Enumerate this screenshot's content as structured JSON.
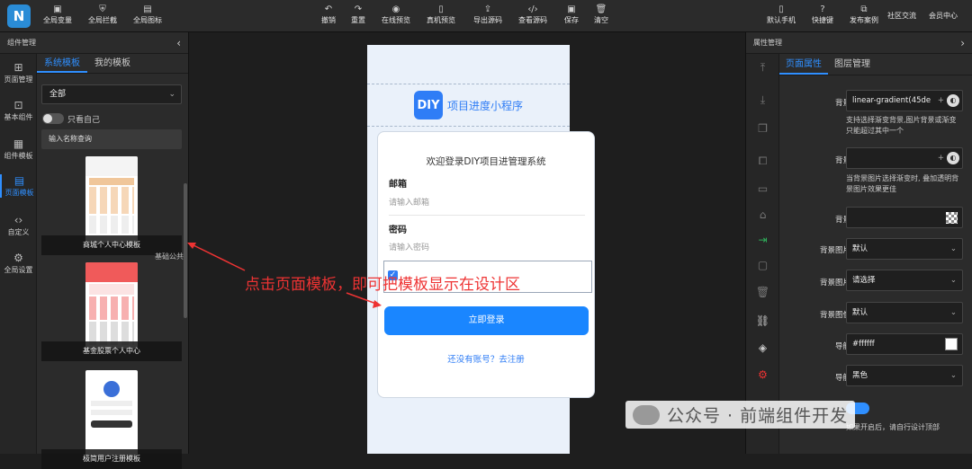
{
  "toolbar": {
    "left": [
      {
        "label": "全局变量",
        "icon": "code-icon"
      },
      {
        "label": "全局拦截",
        "icon": "shield-icon"
      },
      {
        "label": "全局图标",
        "icon": "image-icon"
      }
    ],
    "center": [
      {
        "label": "撤销",
        "icon": "undo-icon"
      },
      {
        "label": "重置",
        "icon": "redo-icon"
      },
      {
        "label": "在线预览",
        "icon": "eye-icon"
      },
      {
        "label": "真机预览",
        "icon": "phone-icon"
      },
      {
        "label": "导出源码",
        "icon": "export-icon"
      },
      {
        "label": "查看源码",
        "icon": "code-icon"
      },
      {
        "label": "保存",
        "icon": "save-icon"
      },
      {
        "label": "清空",
        "icon": "trash-icon"
      }
    ],
    "right": [
      {
        "label": "默认手机",
        "icon": "phone-icon"
      },
      {
        "label": "快捷键",
        "icon": "help-icon"
      },
      {
        "label": "发布案例",
        "icon": "publish-icon"
      },
      {
        "label": "社区交流",
        "icon": ""
      },
      {
        "label": "会员中心",
        "icon": ""
      }
    ]
  },
  "left_panel": {
    "title": "组件管理",
    "nav": [
      {
        "label": "页面管理",
        "icon": "layout-icon"
      },
      {
        "label": "基本组件",
        "icon": "component-icon"
      },
      {
        "label": "组件模板",
        "icon": "template-icon"
      },
      {
        "label": "页面模板",
        "icon": "page-template-icon",
        "active": true
      },
      {
        "label": "自定义",
        "icon": "custom-code-icon"
      },
      {
        "label": "全局设置",
        "icon": "settings-icon"
      }
    ],
    "tabs": [
      "系统模板",
      "我的模板"
    ],
    "category_select": "全部",
    "only_mine_label": "只看自己",
    "search_placeholder": "输入名称查询",
    "templates": [
      {
        "label": "商城个人中心模板",
        "tag": "基础公共"
      },
      {
        "label": "基金股票个人中心"
      },
      {
        "label": "极简用户注册模板"
      }
    ]
  },
  "phone": {
    "logo": "DIY",
    "title": "项目进度小程序",
    "welcome": "欢迎登录DIY项目进管理系统",
    "email_label": "邮箱",
    "email_placeholder": "请输入邮箱",
    "password_label": "密码",
    "password_placeholder": "请输入密码",
    "login_button": "立即登录",
    "register_link": "还没有账号？去注册"
  },
  "annotation": "点击页面模板，即可把模板显示在设计区",
  "right_panel": {
    "title": "属性管理",
    "tabs": [
      "页面属性",
      "图层管理"
    ],
    "props": [
      {
        "label": "背景图片",
        "value": "linear-gradient(45de",
        "help": "支持选择渐变背景,图片背景或渐变只能超过其中一个"
      },
      {
        "label": "背景叠加",
        "value": "",
        "help": "当背景图片选择渐变时, 叠加透明背景图片效果更佳"
      },
      {
        "label": "背景颜色",
        "value": ""
      },
      {
        "label": "背景图片位置",
        "value": "默认"
      },
      {
        "label": "背景图片大小",
        "value": "请选择"
      },
      {
        "label": "背景图像重复",
        "value": "默认"
      },
      {
        "label": "导航背景",
        "value": "#ffffff"
      },
      {
        "label": "导航颜色",
        "value": "黑色"
      },
      {
        "label": "",
        "help": "如果开启后，请自行设计顶部"
      }
    ]
  },
  "watermark": "公众号 · 前端组件开发",
  "colors": {
    "accent": "#2f8fff",
    "button": "#1a86ff",
    "annotation": "#e33333"
  }
}
